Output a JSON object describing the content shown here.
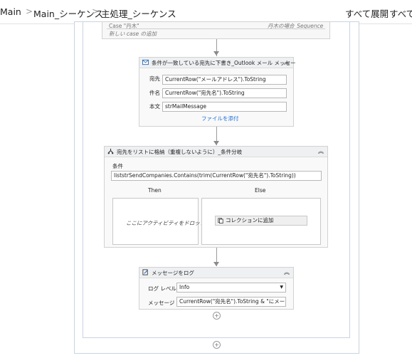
{
  "breadcrumb": [
    "Main",
    "Main_シーケンス",
    "主処理_シーケンス"
  ],
  "toolbar": {
    "expand_all": "すべて展開",
    "collapse_all_partial": "すべて折"
  },
  "switch_block": {
    "case_label": "Case \"丹木\"",
    "case_right": "丹木の場合_Sequence",
    "add_case": "新しい case の追加"
  },
  "outlook_activity": {
    "title": "条件が一致している宛先に下書き_Outlook メール メッセー",
    "to_label": "宛先",
    "to_value": "CurrentRow(\"メールアドレス\").ToString",
    "subject_label": "件名",
    "subject_value": "CurrentRow(\"宛先名\").ToString",
    "body_label": "本文",
    "body_value": "strMailMessage",
    "attach_link": "ファイルを添付"
  },
  "if_activity": {
    "title": "宛先をリストに格納（重複しないように）_条件分岐",
    "condition_label": "条件",
    "condition_value": "liststrSendCompanies.Contains(trim(CurrentRow(\"宛先名\").ToString))",
    "then_label": "Then",
    "else_label": "Else",
    "drop_hint": "ここにアクティビティをドロップ",
    "else_activity": "コレクションに追加"
  },
  "log_activity": {
    "title": "メッセージをログ",
    "level_label": "ログ レベル",
    "level_value": "Info",
    "message_label": "メッセージ",
    "message_value": "CurrentRow(\"宛先名\").ToString & \"にメールを"
  },
  "icons": {
    "chevron": "chevron-right-icon",
    "collapse": "double-chevron-up-icon",
    "add": "add-circle-icon"
  },
  "colors": {
    "link": "#1a6fd6",
    "frame": "#c9d3e0"
  }
}
